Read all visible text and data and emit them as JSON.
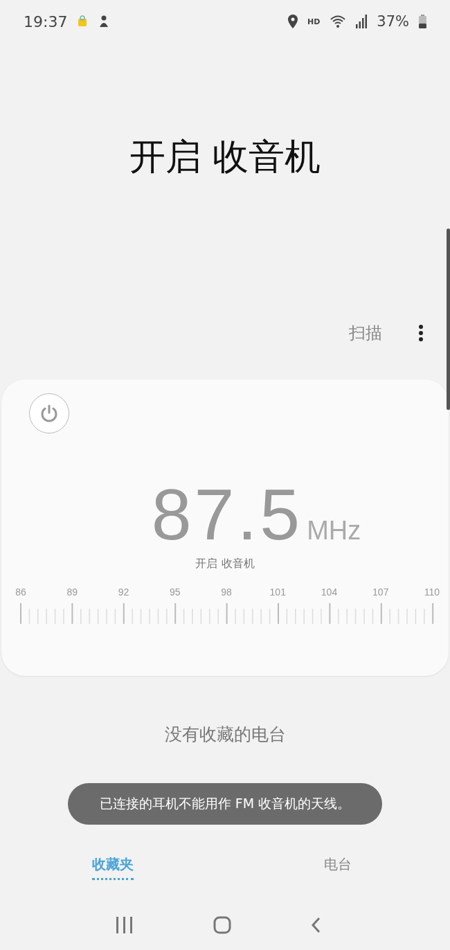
{
  "status_bar": {
    "time": "19:37",
    "hd": "HD",
    "battery": "37%"
  },
  "title": "开启 收音机",
  "toolbar": {
    "scan": "扫描"
  },
  "tuner": {
    "power_on": false,
    "frequency": "87.5",
    "unit": "MHz",
    "caption": "开启 收音机",
    "scale_labels": [
      "86",
      "89",
      "92",
      "95",
      "98",
      "101",
      "104",
      "107",
      "110"
    ]
  },
  "favorites": {
    "empty_title": "没有收藏的电台"
  },
  "toast": "已连接的耳机不能用作 FM 收音机的天线。",
  "tabs": [
    {
      "label": "收藏夹",
      "selected": true
    },
    {
      "label": "电台",
      "selected": false
    }
  ]
}
